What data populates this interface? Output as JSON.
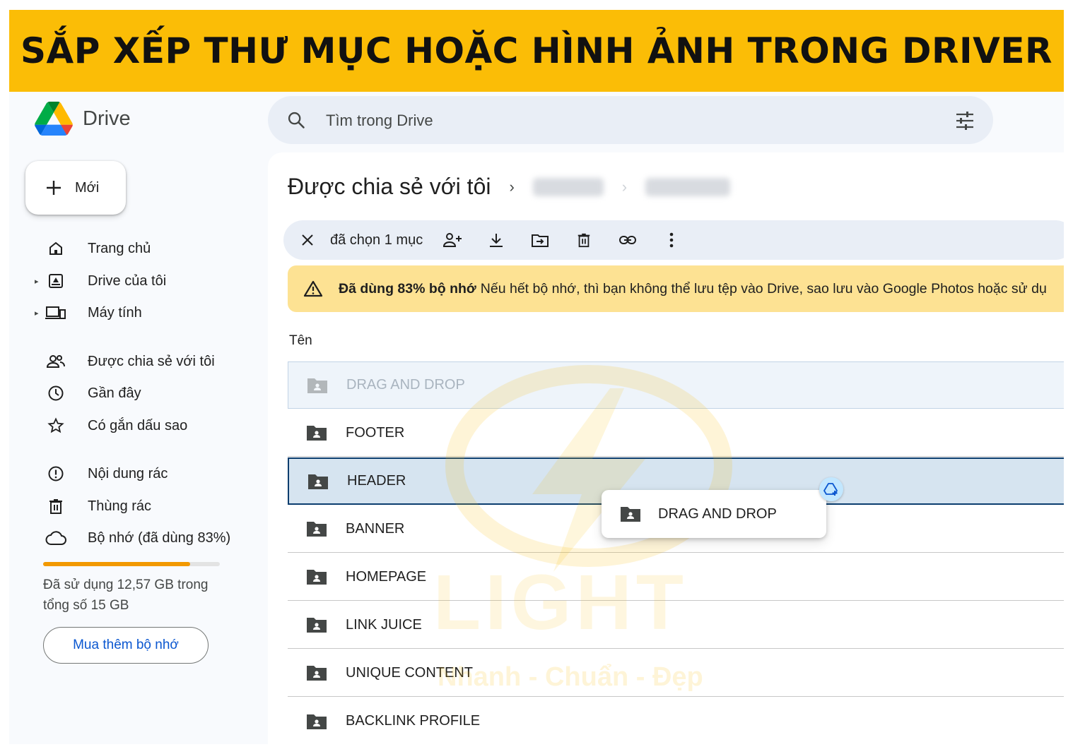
{
  "banner": {
    "title": "SẮP XẾP THƯ MỤC HOẶC HÌNH ẢNH TRONG DRIVER"
  },
  "header": {
    "logo_text": "Drive",
    "search_placeholder": "Tìm trong Drive"
  },
  "sidebar": {
    "new_label": "Mới",
    "items": [
      {
        "label": "Trang chủ",
        "icon": "home-icon"
      },
      {
        "label": "Drive của tôi",
        "icon": "my-drive-icon"
      },
      {
        "label": "Máy tính",
        "icon": "computer-icon"
      },
      {
        "label": "Được chia sẻ với tôi",
        "icon": "shared-icon"
      },
      {
        "label": "Gần đây",
        "icon": "clock-icon"
      },
      {
        "label": "Có gắn dấu sao",
        "icon": "star-icon"
      },
      {
        "label": "Nội dung rác",
        "icon": "spam-icon"
      },
      {
        "label": "Thùng rác",
        "icon": "trash-icon"
      },
      {
        "label": "Bộ nhớ (đã dùng 83%)",
        "icon": "cloud-icon"
      }
    ],
    "storage": {
      "used_fraction": 0.83,
      "text": "Đã sử dụng 12,57 GB trong tổng số 15 GB"
    },
    "buy_label": "Mua thêm bộ nhớ"
  },
  "main": {
    "breadcrumb_title": "Được chia sẻ với tôi",
    "toolbar": {
      "selected_count": "đã chọn 1 mục"
    },
    "warning": {
      "bold": "Đã dùng 83% bộ nhớ",
      "text": "Nếu hết bộ nhớ, thì bạn không thể lưu tệp vào Drive, sao lưu vào Google Photos hoặc sử dụ"
    },
    "column_name": "Tên",
    "rows": [
      {
        "name": "DRAG AND DROP",
        "state": "dragging"
      },
      {
        "name": "FOOTER",
        "state": "normal"
      },
      {
        "name": "HEADER",
        "state": "drop-target"
      },
      {
        "name": "BANNER",
        "state": "normal"
      },
      {
        "name": "HOMEPAGE",
        "state": "normal"
      },
      {
        "name": "LINK JUICE",
        "state": "normal"
      },
      {
        "name": "UNIQUE CONTENT",
        "state": "normal"
      },
      {
        "name": "BACKLINK PROFILE",
        "state": "normal"
      }
    ],
    "drag_card": {
      "name": "DRAG AND DROP"
    }
  },
  "watermark": {
    "brand": "LIGHT",
    "tagline": "Nhanh - Chuẩn - Đẹp"
  },
  "colors": {
    "banner": "#fbbd06",
    "accent": "#0b57d0",
    "storage": "#f29900",
    "warning": "#fde293"
  }
}
